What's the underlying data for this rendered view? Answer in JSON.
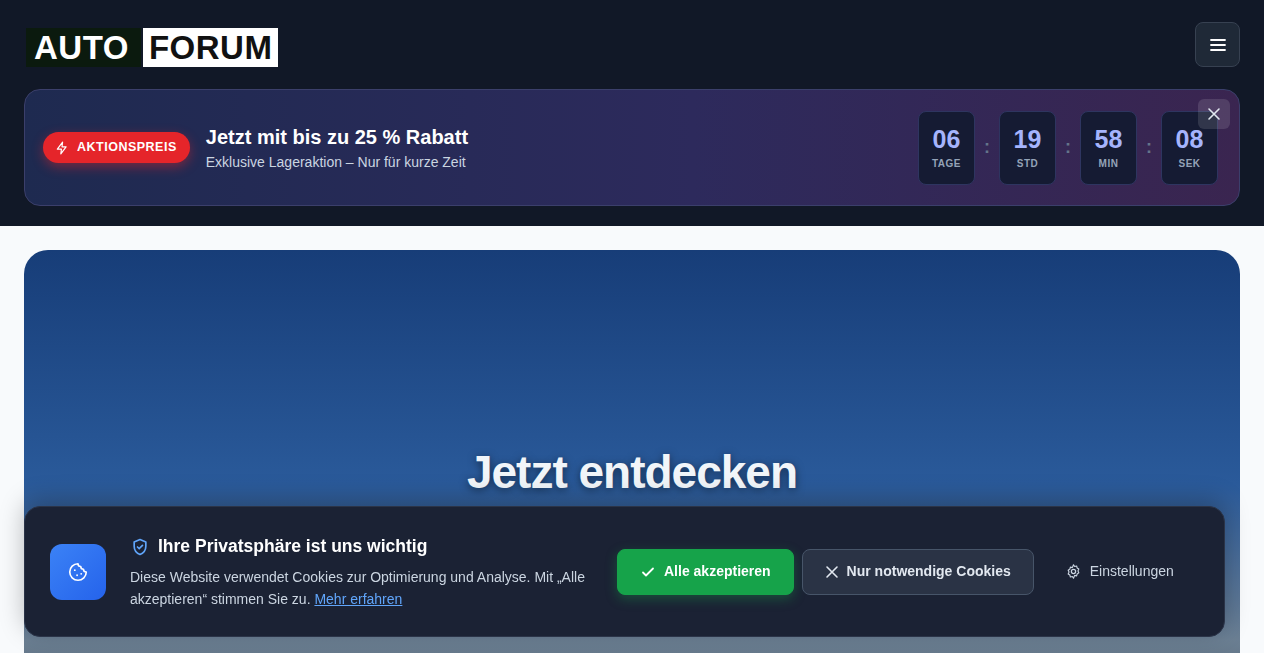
{
  "logo": {
    "part1": "AUTO",
    "part2": "FORUM"
  },
  "promo": {
    "badge": "AKTIONSPREIS",
    "title": "Jetzt mit bis zu 25 % Rabatt",
    "subtitle": "Exklusive Lageraktion – Nur für kurze Zeit",
    "separator": ":",
    "countdown": [
      {
        "value": "06",
        "unit": "TAGE"
      },
      {
        "value": "19",
        "unit": "STD"
      },
      {
        "value": "58",
        "unit": "MIN"
      },
      {
        "value": "08",
        "unit": "SEK"
      }
    ]
  },
  "hero": {
    "title": "Jetzt entdecken"
  },
  "cookie": {
    "title": "Ihre Privatsphäre ist uns wichtig",
    "text": "Diese Website verwendet Cookies zur Optimierung und Analyse. Mit „Alle akzeptieren“ stimmen Sie zu.",
    "link": "Mehr erfahren",
    "buttons": [
      {
        "label": "Alle akzeptieren",
        "kind": "primary"
      },
      {
        "label": "Nur notwendige Cookies",
        "kind": "secondary"
      },
      {
        "label": "Einstellungen",
        "kind": "link"
      }
    ]
  }
}
